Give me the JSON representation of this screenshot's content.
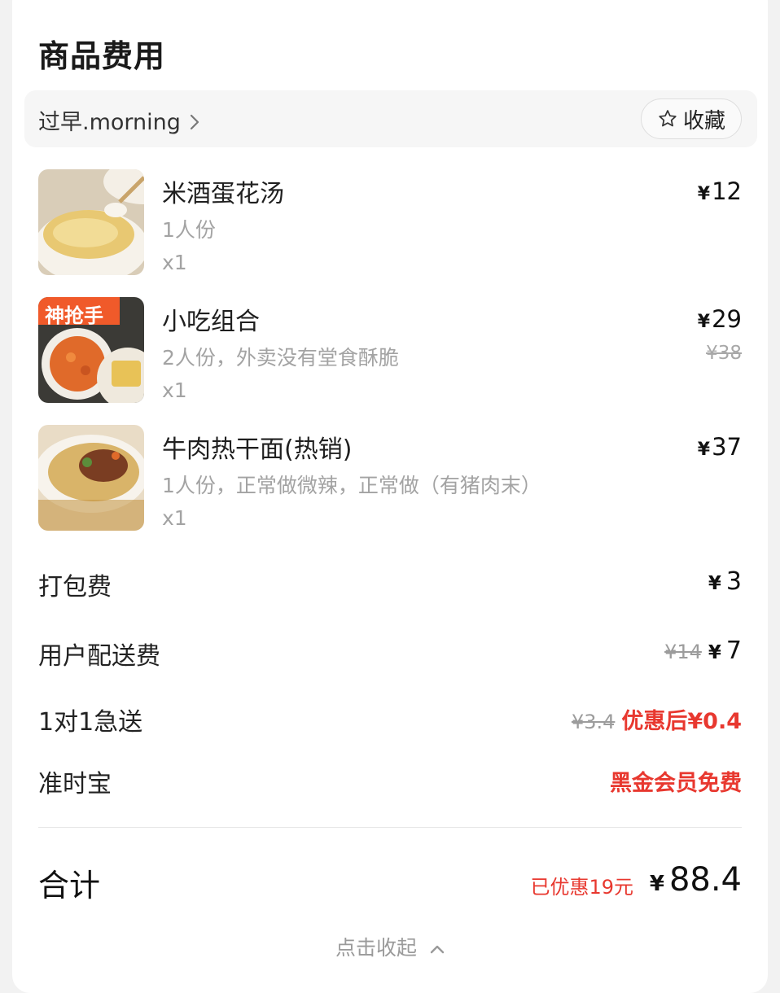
{
  "section_title": "商品费用",
  "shop": {
    "name": "过早.morning",
    "favorite_label": "收藏"
  },
  "items": [
    {
      "name": "米酒蛋花汤",
      "spec": "1人份",
      "qty": "x1",
      "price": "12",
      "original_price": ""
    },
    {
      "name": "小吃组合",
      "spec": "2人份，外卖没有堂食酥脆",
      "qty": "x1",
      "price": "29",
      "original_price": "¥38",
      "badge": "神抢手"
    },
    {
      "name": "牛肉热干面(热销)",
      "spec": "1人份，正常做微辣，正常做（有猪肉末）",
      "qty": "x1",
      "price": "37",
      "original_price": ""
    }
  ],
  "fees": {
    "packing": {
      "label": "打包费",
      "value": "3"
    },
    "delivery": {
      "label": "用户配送费",
      "original": "¥14",
      "value": "7"
    },
    "express": {
      "label": "1对1急送",
      "original": "¥3.4",
      "value": "优惠后¥0.4"
    },
    "ontime": {
      "label": "准时宝",
      "value": "黑金会员免费"
    }
  },
  "total": {
    "label": "合计",
    "discount": "已优惠19元",
    "value": "88.4"
  },
  "collapse_label": "点击收起",
  "currency": "¥",
  "colors": {
    "accent_red": "#e8382f",
    "muted": "#a3a3a3"
  }
}
